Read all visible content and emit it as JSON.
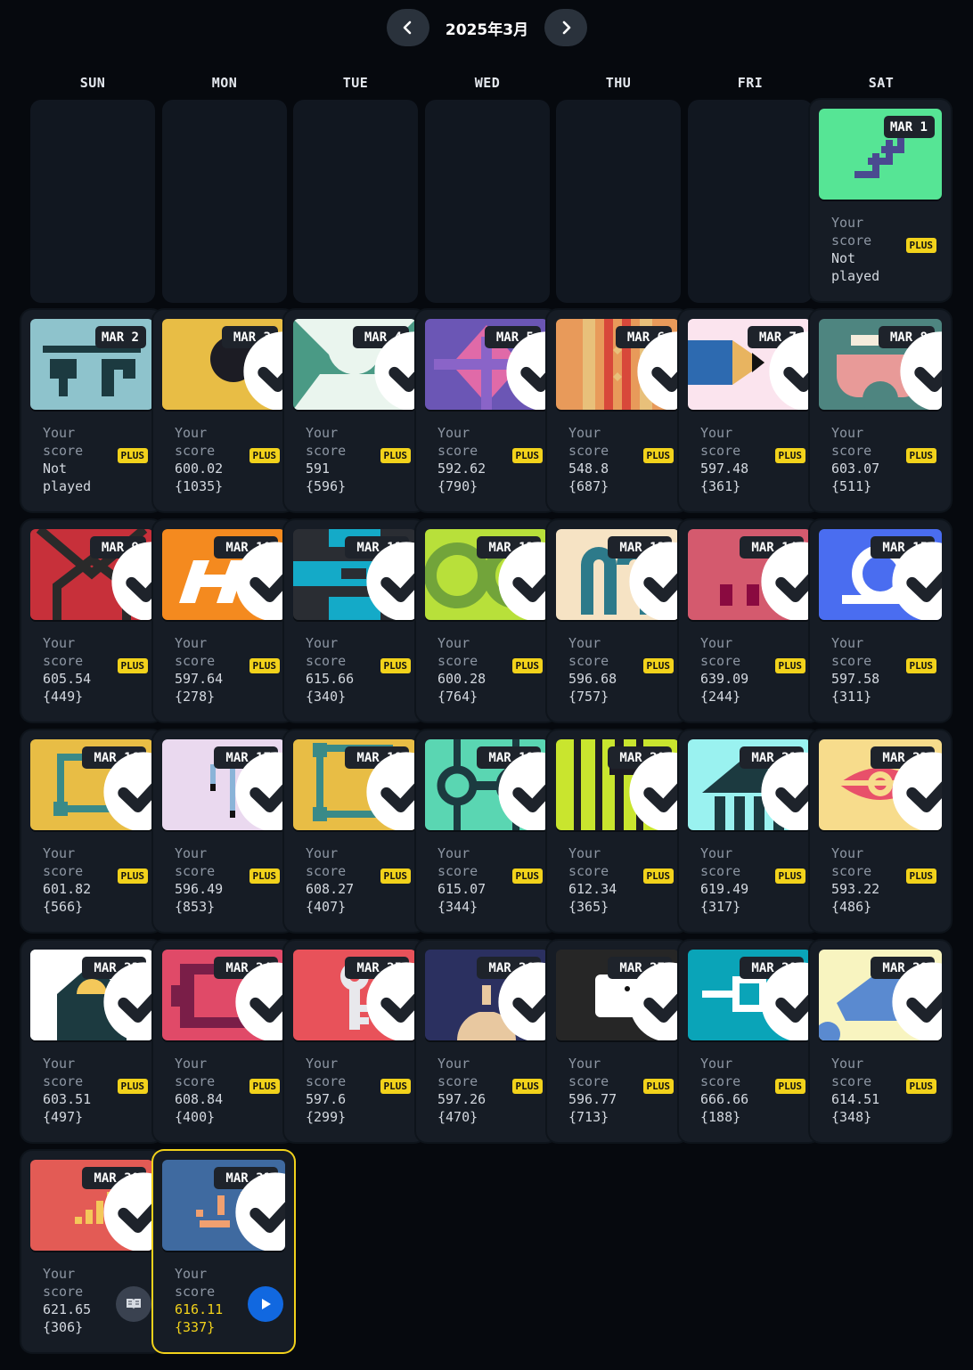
{
  "header": {
    "month_label": "2025年3月",
    "prev_icon": "chevron-left-icon",
    "next_icon": "chevron-right-icon"
  },
  "weekdays": [
    "SUN",
    "MON",
    "TUE",
    "WED",
    "THU",
    "FRI",
    "SAT"
  ],
  "score_label": [
    "Your",
    "score"
  ],
  "plus_label": "PLUS",
  "days": [
    {
      "date": "MAR 1",
      "col": 6,
      "row": 0,
      "checked": false,
      "score": "Not",
      "rank": "played",
      "plus": true,
      "art": "arrows",
      "bg": "#56e595"
    },
    {
      "date": "MAR 2",
      "col": 0,
      "row": 1,
      "checked": false,
      "score": "Not",
      "rank": "played",
      "plus": true,
      "art": "glyph",
      "bg": "#8ec3cc"
    },
    {
      "date": "MAR 3",
      "col": 1,
      "row": 1,
      "checked": true,
      "score": "600.02",
      "rank": "{1035}",
      "plus": true,
      "art": "bird",
      "bg": "#e8bd45"
    },
    {
      "date": "MAR 4",
      "col": 2,
      "row": 1,
      "checked": true,
      "score": "591",
      "rank": "{596}",
      "plus": true,
      "art": "envelope",
      "bg": "#4a9a85"
    },
    {
      "date": "MAR 5",
      "col": 3,
      "row": 1,
      "checked": true,
      "score": "592.62",
      "rank": "{790}",
      "plus": true,
      "art": "triangles",
      "bg": "#6b56b5"
    },
    {
      "date": "MAR 6",
      "col": 4,
      "row": 1,
      "checked": true,
      "score": "548.8",
      "rank": "{687}",
      "plus": true,
      "art": "stripes",
      "bg": "#e89a5a"
    },
    {
      "date": "MAR 7",
      "col": 5,
      "row": 1,
      "checked": true,
      "score": "597.48",
      "rank": "{361}",
      "plus": true,
      "art": "pencil",
      "bg": "#fbe4ee"
    },
    {
      "date": "MAR 8",
      "col": 6,
      "row": 1,
      "checked": true,
      "score": "603.07",
      "rank": "{511}",
      "plus": true,
      "art": "bowl",
      "bg": "#4e8580"
    },
    {
      "date": "MAR 9",
      "col": 0,
      "row": 2,
      "checked": true,
      "score": "605.54",
      "rank": "{449}",
      "plus": true,
      "art": "house",
      "bg": "#c7303a"
    },
    {
      "date": "MAR 10",
      "col": 1,
      "row": 2,
      "checked": true,
      "score": "597.64",
      "rank": "{278}",
      "plus": true,
      "art": "letterh",
      "bg": "#f48a1f"
    },
    {
      "date": "MAR 11",
      "col": 2,
      "row": 2,
      "checked": true,
      "score": "615.66",
      "rank": "{340}",
      "plus": true,
      "art": "cross",
      "bg": "#2a2d33"
    },
    {
      "date": "MAR 12",
      "col": 3,
      "row": 2,
      "checked": true,
      "score": "600.28",
      "rank": "{764}",
      "plus": true,
      "art": "rings",
      "bg": "#b8e03a"
    },
    {
      "date": "MAR 13",
      "col": 4,
      "row": 2,
      "checked": true,
      "score": "596.68",
      "rank": "{757}",
      "plus": true,
      "art": "letterm",
      "bg": "#f6e3c4"
    },
    {
      "date": "MAR 14",
      "col": 5,
      "row": 2,
      "checked": true,
      "score": "639.09",
      "rank": "{244}",
      "plus": true,
      "art": "dots",
      "bg": "#d45a6e"
    },
    {
      "date": "MAR 15",
      "col": 6,
      "row": 2,
      "checked": true,
      "score": "597.58",
      "rank": "{311}",
      "plus": true,
      "art": "scale",
      "bg": "#4a6df0"
    },
    {
      "date": "MAR 16",
      "col": 0,
      "row": 3,
      "checked": true,
      "score": "601.82",
      "rank": "{566}",
      "plus": true,
      "art": "frame",
      "bg": "#e8bd45"
    },
    {
      "date": "MAR 17",
      "col": 1,
      "row": 3,
      "checked": true,
      "score": "596.49",
      "rank": "{853}",
      "plus": true,
      "art": "sticks",
      "bg": "#ead9ef"
    },
    {
      "date": "MAR 18",
      "col": 2,
      "row": 3,
      "checked": true,
      "score": "608.27",
      "rank": "{407}",
      "plus": true,
      "art": "frame2",
      "bg": "#e8bd45"
    },
    {
      "date": "MAR 19",
      "col": 3,
      "row": 3,
      "checked": true,
      "score": "615.07",
      "rank": "{344}",
      "plus": true,
      "art": "dumbbell",
      "bg": "#5ad6b2"
    },
    {
      "date": "MAR 20",
      "col": 4,
      "row": 3,
      "checked": true,
      "score": "612.34",
      "rank": "{365}",
      "plus": true,
      "art": "bars",
      "bg": "#c9e52e"
    },
    {
      "date": "MAR 21",
      "col": 5,
      "row": 3,
      "checked": true,
      "score": "619.49",
      "rank": "{317}",
      "plus": true,
      "art": "temple",
      "bg": "#9af2f0"
    },
    {
      "date": "MAR 22",
      "col": 6,
      "row": 3,
      "checked": true,
      "score": "593.22",
      "rank": "{486}",
      "plus": true,
      "art": "eye",
      "bg": "#f7dc8c"
    },
    {
      "date": "MAR 23",
      "col": 0,
      "row": 4,
      "checked": true,
      "score": "603.51",
      "rank": "{497}",
      "plus": true,
      "art": "dome",
      "bg": "#ffffff"
    },
    {
      "date": "MAR 24",
      "col": 1,
      "row": 4,
      "checked": true,
      "score": "608.84",
      "rank": "{400}",
      "plus": true,
      "art": "crab",
      "bg": "#e04a68"
    },
    {
      "date": "MAR 25",
      "col": 2,
      "row": 4,
      "checked": true,
      "score": "597.6",
      "rank": "{299}",
      "plus": true,
      "art": "key",
      "bg": "#e8525a"
    },
    {
      "date": "MAR 26",
      "col": 3,
      "row": 4,
      "checked": true,
      "score": "597.26",
      "rank": "{470}",
      "plus": true,
      "art": "plug",
      "bg": "#2b3060"
    },
    {
      "date": "MAR 27",
      "col": 4,
      "row": 4,
      "checked": true,
      "score": "596.77",
      "rank": "{713}",
      "plus": true,
      "art": "chick",
      "bg": "#262626"
    },
    {
      "date": "MAR 28",
      "col": 5,
      "row": 4,
      "checked": true,
      "score": "666.66",
      "rank": "{188}",
      "plus": true,
      "art": "chip",
      "bg": "#0aa4b8"
    },
    {
      "date": "MAR 29",
      "col": 6,
      "row": 4,
      "checked": true,
      "score": "614.51",
      "rank": "{348}",
      "plus": true,
      "art": "map",
      "bg": "#f8f4c0"
    },
    {
      "date": "MAR 30",
      "col": 0,
      "row": 5,
      "checked": true,
      "score": "621.65",
      "rank": "{306}",
      "plus": false,
      "action": "book-icon",
      "art": "signal",
      "bg": "#e35b55"
    },
    {
      "date": "MAR 31",
      "col": 1,
      "row": 5,
      "checked": true,
      "score": "616.11",
      "rank": "{337}",
      "plus": false,
      "action": "play-icon",
      "current": true,
      "art": "face",
      "bg": "#3f6aa0"
    }
  ]
}
